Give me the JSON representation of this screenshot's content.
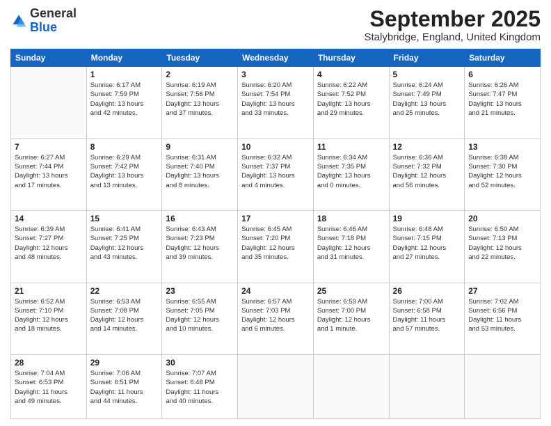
{
  "header": {
    "logo_general": "General",
    "logo_blue": "Blue",
    "month_title": "September 2025",
    "location": "Stalybridge, England, United Kingdom"
  },
  "weekdays": [
    "Sunday",
    "Monday",
    "Tuesday",
    "Wednesday",
    "Thursday",
    "Friday",
    "Saturday"
  ],
  "weeks": [
    [
      {
        "day": "",
        "info": ""
      },
      {
        "day": "1",
        "info": "Sunrise: 6:17 AM\nSunset: 7:59 PM\nDaylight: 13 hours\nand 42 minutes."
      },
      {
        "day": "2",
        "info": "Sunrise: 6:19 AM\nSunset: 7:56 PM\nDaylight: 13 hours\nand 37 minutes."
      },
      {
        "day": "3",
        "info": "Sunrise: 6:20 AM\nSunset: 7:54 PM\nDaylight: 13 hours\nand 33 minutes."
      },
      {
        "day": "4",
        "info": "Sunrise: 6:22 AM\nSunset: 7:52 PM\nDaylight: 13 hours\nand 29 minutes."
      },
      {
        "day": "5",
        "info": "Sunrise: 6:24 AM\nSunset: 7:49 PM\nDaylight: 13 hours\nand 25 minutes."
      },
      {
        "day": "6",
        "info": "Sunrise: 6:26 AM\nSunset: 7:47 PM\nDaylight: 13 hours\nand 21 minutes."
      }
    ],
    [
      {
        "day": "7",
        "info": "Sunrise: 6:27 AM\nSunset: 7:44 PM\nDaylight: 13 hours\nand 17 minutes."
      },
      {
        "day": "8",
        "info": "Sunrise: 6:29 AM\nSunset: 7:42 PM\nDaylight: 13 hours\nand 13 minutes."
      },
      {
        "day": "9",
        "info": "Sunrise: 6:31 AM\nSunset: 7:40 PM\nDaylight: 13 hours\nand 8 minutes."
      },
      {
        "day": "10",
        "info": "Sunrise: 6:32 AM\nSunset: 7:37 PM\nDaylight: 13 hours\nand 4 minutes."
      },
      {
        "day": "11",
        "info": "Sunrise: 6:34 AM\nSunset: 7:35 PM\nDaylight: 13 hours\nand 0 minutes."
      },
      {
        "day": "12",
        "info": "Sunrise: 6:36 AM\nSunset: 7:32 PM\nDaylight: 12 hours\nand 56 minutes."
      },
      {
        "day": "13",
        "info": "Sunrise: 6:38 AM\nSunset: 7:30 PM\nDaylight: 12 hours\nand 52 minutes."
      }
    ],
    [
      {
        "day": "14",
        "info": "Sunrise: 6:39 AM\nSunset: 7:27 PM\nDaylight: 12 hours\nand 48 minutes."
      },
      {
        "day": "15",
        "info": "Sunrise: 6:41 AM\nSunset: 7:25 PM\nDaylight: 12 hours\nand 43 minutes."
      },
      {
        "day": "16",
        "info": "Sunrise: 6:43 AM\nSunset: 7:23 PM\nDaylight: 12 hours\nand 39 minutes."
      },
      {
        "day": "17",
        "info": "Sunrise: 6:45 AM\nSunset: 7:20 PM\nDaylight: 12 hours\nand 35 minutes."
      },
      {
        "day": "18",
        "info": "Sunrise: 6:46 AM\nSunset: 7:18 PM\nDaylight: 12 hours\nand 31 minutes."
      },
      {
        "day": "19",
        "info": "Sunrise: 6:48 AM\nSunset: 7:15 PM\nDaylight: 12 hours\nand 27 minutes."
      },
      {
        "day": "20",
        "info": "Sunrise: 6:50 AM\nSunset: 7:13 PM\nDaylight: 12 hours\nand 22 minutes."
      }
    ],
    [
      {
        "day": "21",
        "info": "Sunrise: 6:52 AM\nSunset: 7:10 PM\nDaylight: 12 hours\nand 18 minutes."
      },
      {
        "day": "22",
        "info": "Sunrise: 6:53 AM\nSunset: 7:08 PM\nDaylight: 12 hours\nand 14 minutes."
      },
      {
        "day": "23",
        "info": "Sunrise: 6:55 AM\nSunset: 7:05 PM\nDaylight: 12 hours\nand 10 minutes."
      },
      {
        "day": "24",
        "info": "Sunrise: 6:57 AM\nSunset: 7:03 PM\nDaylight: 12 hours\nand 6 minutes."
      },
      {
        "day": "25",
        "info": "Sunrise: 6:59 AM\nSunset: 7:00 PM\nDaylight: 12 hours\nand 1 minute."
      },
      {
        "day": "26",
        "info": "Sunrise: 7:00 AM\nSunset: 6:58 PM\nDaylight: 11 hours\nand 57 minutes."
      },
      {
        "day": "27",
        "info": "Sunrise: 7:02 AM\nSunset: 6:56 PM\nDaylight: 11 hours\nand 53 minutes."
      }
    ],
    [
      {
        "day": "28",
        "info": "Sunrise: 7:04 AM\nSunset: 6:53 PM\nDaylight: 11 hours\nand 49 minutes."
      },
      {
        "day": "29",
        "info": "Sunrise: 7:06 AM\nSunset: 6:51 PM\nDaylight: 11 hours\nand 44 minutes."
      },
      {
        "day": "30",
        "info": "Sunrise: 7:07 AM\nSunset: 6:48 PM\nDaylight: 11 hours\nand 40 minutes."
      },
      {
        "day": "",
        "info": ""
      },
      {
        "day": "",
        "info": ""
      },
      {
        "day": "",
        "info": ""
      },
      {
        "day": "",
        "info": ""
      }
    ]
  ]
}
